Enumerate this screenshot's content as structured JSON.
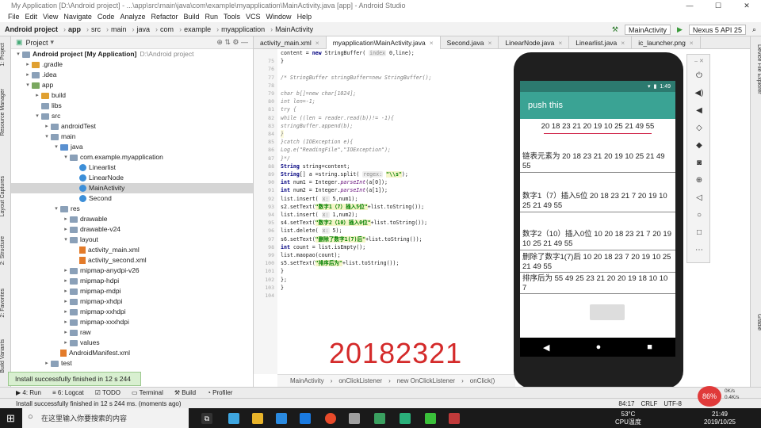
{
  "window": {
    "title": "My Application [D:\\Android project] - ...\\app\\src\\main\\java\\com\\example\\myapplication\\MainActivity.java [app] - Android Studio"
  },
  "menu": [
    "File",
    "Edit",
    "View",
    "Navigate",
    "Code",
    "Analyze",
    "Refactor",
    "Build",
    "Run",
    "Tools",
    "VCS",
    "Window",
    "Help"
  ],
  "nav": {
    "crumbs": [
      "Android project",
      "app",
      "src",
      "main",
      "java",
      "com",
      "example",
      "myapplication",
      "MainActivity"
    ],
    "run_config": "MainActivity",
    "device": "Nexus 5 API 25"
  },
  "project": {
    "header": "Project",
    "tree": [
      {
        "label": "Android project [My Application]",
        "extra": "D:\\Android project",
        "indent": 0,
        "arrow": "▾",
        "icon": "folder"
      },
      {
        "label": ".gradle",
        "indent": 1,
        "arrow": "▸",
        "icon": "folder-o"
      },
      {
        "label": ".idea",
        "indent": 1,
        "arrow": "▸",
        "icon": "folder"
      },
      {
        "label": "app",
        "indent": 1,
        "arrow": "▾",
        "icon": "folder-g"
      },
      {
        "label": "build",
        "indent": 2,
        "arrow": "▸",
        "icon": "folder-o"
      },
      {
        "label": "libs",
        "indent": 2,
        "arrow": "",
        "icon": "folder"
      },
      {
        "label": "src",
        "indent": 2,
        "arrow": "▾",
        "icon": "folder"
      },
      {
        "label": "androidTest",
        "indent": 3,
        "arrow": "▸",
        "icon": "folder"
      },
      {
        "label": "main",
        "indent": 3,
        "arrow": "▾",
        "icon": "folder"
      },
      {
        "label": "java",
        "indent": 4,
        "arrow": "▾",
        "icon": "folder-b"
      },
      {
        "label": "com.example.myapplication",
        "indent": 5,
        "arrow": "▾",
        "icon": "folder"
      },
      {
        "label": "Linearlist",
        "indent": 6,
        "arrow": "",
        "icon": "class"
      },
      {
        "label": "LinearNode",
        "indent": 6,
        "arrow": "",
        "icon": "class"
      },
      {
        "label": "MainActivity",
        "indent": 6,
        "arrow": "",
        "icon": "class",
        "selected": true
      },
      {
        "label": "Second",
        "indent": 6,
        "arrow": "",
        "icon": "class"
      },
      {
        "label": "res",
        "indent": 4,
        "arrow": "▾",
        "icon": "folder"
      },
      {
        "label": "drawable",
        "indent": 5,
        "arrow": "▸",
        "icon": "folder"
      },
      {
        "label": "drawable-v24",
        "indent": 5,
        "arrow": "▸",
        "icon": "folder"
      },
      {
        "label": "layout",
        "indent": 5,
        "arrow": "▾",
        "icon": "folder"
      },
      {
        "label": "activity_main.xml",
        "indent": 6,
        "arrow": "",
        "icon": "xml"
      },
      {
        "label": "activity_second.xml",
        "indent": 6,
        "arrow": "",
        "icon": "xml"
      },
      {
        "label": "mipmap-anydpi-v26",
        "indent": 5,
        "arrow": "▸",
        "icon": "folder"
      },
      {
        "label": "mipmap-hdpi",
        "indent": 5,
        "arrow": "▸",
        "icon": "folder"
      },
      {
        "label": "mipmap-mdpi",
        "indent": 5,
        "arrow": "▸",
        "icon": "folder"
      },
      {
        "label": "mipmap-xhdpi",
        "indent": 5,
        "arrow": "▸",
        "icon": "folder"
      },
      {
        "label": "mipmap-xxhdpi",
        "indent": 5,
        "arrow": "▸",
        "icon": "folder"
      },
      {
        "label": "mipmap-xxxhdpi",
        "indent": 5,
        "arrow": "▸",
        "icon": "folder"
      },
      {
        "label": "raw",
        "indent": 5,
        "arrow": "▸",
        "icon": "folder"
      },
      {
        "label": "values",
        "indent": 5,
        "arrow": "▸",
        "icon": "folder"
      },
      {
        "label": "AndroidManifest.xml",
        "indent": 4,
        "arrow": "",
        "icon": "xml"
      },
      {
        "label": "test",
        "indent": 3,
        "arrow": "▸",
        "icon": "folder"
      }
    ]
  },
  "left_tabs": [
    "1: Project",
    "Resource Manager",
    "Layout Captures",
    "2: Structure",
    "2: Favorites",
    "Build Variants"
  ],
  "tabs": [
    "activity_main.xml",
    "myapplication\\MainActivity.java",
    "Second.java",
    "LinearNode.java",
    "Linearlist.java",
    "ic_launcher.png"
  ],
  "gutter": [
    "",
    "75",
    "76",
    "77",
    "78",
    "79",
    "80",
    "81",
    "82",
    "83",
    "84",
    "85",
    "86",
    "87",
    "88",
    "89",
    "90",
    "91",
    "92",
    "93",
    "94",
    "95",
    "96",
    "97",
    "98",
    "99",
    "100",
    "101",
    "102",
    "103",
    "104"
  ],
  "code": [
    "    content = new StringBuffer( index 0,line);",
    "    }",
    "",
    "    /* StringBuffer stringBuffer=new StringBuffer();",
    "",
    "    char b[]=new char[1024];",
    "    int len=-1;",
    "    try {",
    "        while ((len = reader.read(b))!= -1){",
    "            stringBuffer.append(b);",
    "        }",
    "    }catch (IOException e){",
    "        Log.e(\"ReadingFile\",\"IOException\");",
    "    }*/",
    "    String string=content;",
    "    String[] a =string.split( regex: \"\\\\s\");",
    "     int num1 = Integer.parseInt(a[0]);",
    "     int num2 = Integer.parseInt(a[1]);",
    "     list.insert( x: 5,num1);",
    "     s2.setText(\"数字1（7）插入5位\"+list.toString());",
    "    list.insert( x: 1,num2);",
    "    s4.setText(\"数字2（10）插入0位\"+list.toString());",
    "    list.delete( x: 5);",
    "    s6.setText(\"删除了数字1(7)后\"+list.toString());",
    "    int count = list.isEmpty();",
    "    list.maopao(count);",
    "    s5.setText(\"排序后为\"+list.toString());",
    "  }",
    "};",
    "}"
  ],
  "watermark": "20182321",
  "breadcrumbs_code": [
    "MainActivity",
    "onClickListener",
    "new OnClickListener",
    "onClick()"
  ],
  "bottom_tools": [
    "4: Run",
    "6: Logcat",
    "TODO",
    "Terminal",
    "Build",
    "Profiler"
  ],
  "status": {
    "message": "Install successfully finished in 12 s 244 ms. (moments ago)",
    "position": "84:17",
    "crlf": "CRLF",
    "encoding": "UTF-8"
  },
  "toast": "Install successfully finished in 12 s 244 ms.",
  "phone": {
    "time": "1:49",
    "app_title": "push this",
    "input": "20 18 23 21 20 19 10 25 21 49 55",
    "lines": [
      "链表元素为  20  18  23  21  20  19  10  25  21  49  55",
      "数字1（7）插入5位  20  18  23  21  7  20  19  10  25  21  49  55",
      "数字2（10）插入0位  10  20  18  23  21  7  20  19  10  25  21  49  55",
      "删除了数字1(7)后  10  20  18  23  7  20  19  10  25  21  49  55",
      "排序后为  55  49  25  23  21  20  20  19  18  10  10  7"
    ]
  },
  "right_tabs": [
    "Device File Explorer",
    "Gradle"
  ],
  "taskbar": {
    "search_placeholder": "在这里输入你要搜索的内容",
    "weather": "53°C",
    "weather_sub": "CPU温度",
    "time": "21:49",
    "date": "2019/10/25",
    "cpu": "86%",
    "net_up": "0K/s",
    "net_down": "0.4K/s"
  }
}
